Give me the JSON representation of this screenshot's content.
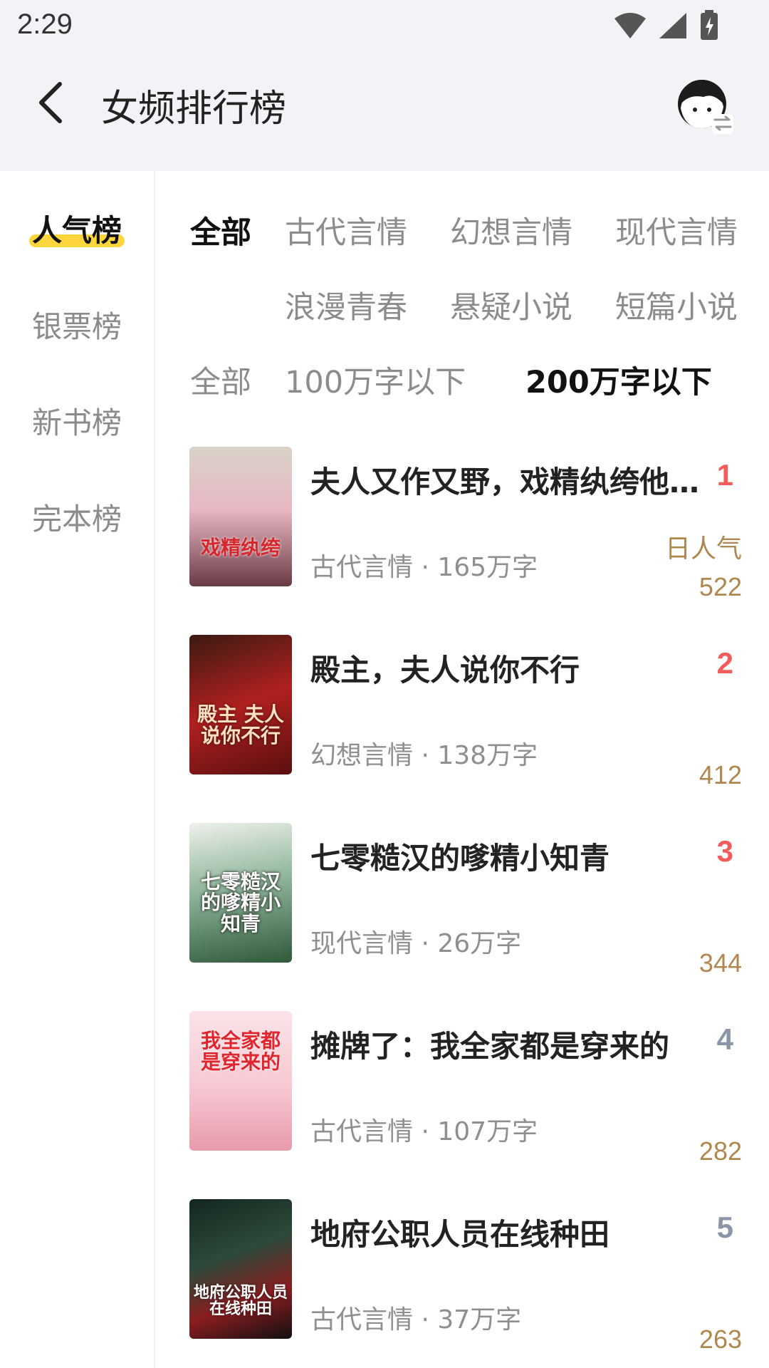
{
  "status_bar": {
    "time": "2:29"
  },
  "header": {
    "title": "女频排行榜"
  },
  "sidebar": {
    "items": [
      {
        "label": "人气榜",
        "active": true
      },
      {
        "label": "银票榜"
      },
      {
        "label": "新书榜"
      },
      {
        "label": "完本榜"
      }
    ]
  },
  "categories": {
    "row1": [
      "全部",
      "古代言情",
      "幻想言情",
      "现代言情"
    ],
    "row2": [
      "浪漫青春",
      "悬疑小说",
      "短篇小说"
    ],
    "active": "全部"
  },
  "word_filters": {
    "items": [
      "全部",
      "100万字以下",
      "200万字以下"
    ],
    "active": "200万字以下"
  },
  "books": [
    {
      "rank": "1",
      "title": "夫人又作又野，戏精纨绔他…",
      "category": "古代言情",
      "words": "165万字",
      "heat_label": "日人气",
      "heat": "522",
      "rank_color": "#f45b5b",
      "cover_text": "戏精纨绔"
    },
    {
      "rank": "2",
      "title": "殿主，夫人说你不行",
      "category": "幻想言情",
      "words": "138万字",
      "heat": "412",
      "rank_color": "#f45b5b",
      "cover_text": "殿主 夫人说你不行"
    },
    {
      "rank": "3",
      "title": "七零糙汉的嗲精小知青",
      "category": "现代言情",
      "words": "26万字",
      "heat": "344",
      "rank_color": "#f45b5b",
      "cover_text": "七零糙汉的嗲精小知青"
    },
    {
      "rank": "4",
      "title": "摊牌了：我全家都是穿来的",
      "category": "古代言情",
      "words": "107万字",
      "heat": "282",
      "rank_color": "#8c95a8",
      "cover_text": "我全家都是穿来的"
    },
    {
      "rank": "5",
      "title": "地府公职人员在线种田",
      "category": "古代言情",
      "words": "37万字",
      "heat": "263",
      "rank_color": "#8c95a8",
      "cover_text": "地府公职人员在线种田"
    }
  ]
}
